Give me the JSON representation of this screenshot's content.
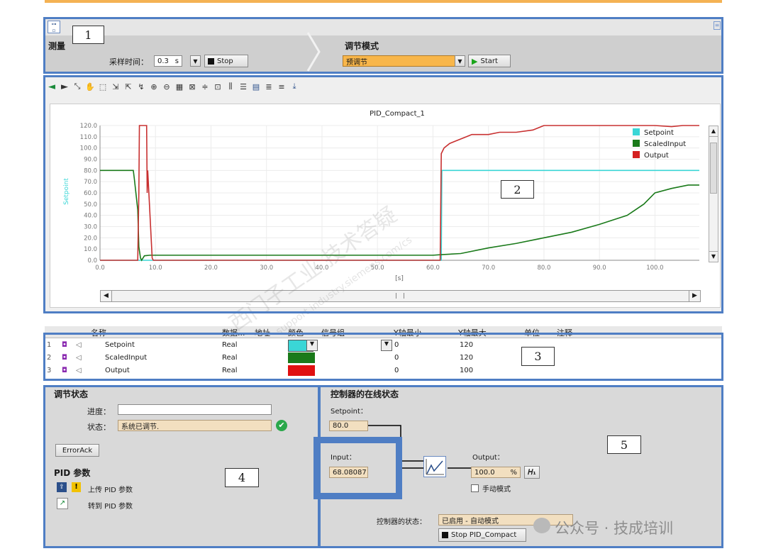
{
  "measure": {
    "title": "测量",
    "sample_time_label": "采样时间：",
    "sample_time_value": "0.3",
    "sample_time_unit": "s",
    "stop_label": "Stop"
  },
  "tuning_mode": {
    "title": "调节模式",
    "selected": "预调节",
    "start_label": "Start"
  },
  "annotations": [
    "1",
    "2",
    "3",
    "4",
    "5"
  ],
  "chart_data": {
    "type": "line",
    "title": "PID_Compact_1",
    "ylabel": "Setpoint",
    "xlabel": "[s]",
    "xlim": [
      0,
      108
    ],
    "ylim": [
      0,
      120
    ],
    "x_ticks": [
      "0.0",
      "10.0",
      "20.0",
      "30.0",
      "40.0",
      "50.0",
      "60.0",
      "70.0",
      "80.0",
      "90.0",
      "100.0"
    ],
    "y_ticks": [
      "120.0",
      "110.0",
      "100.0",
      "90.0",
      "80.0",
      "70.0",
      "60.0",
      "50.0",
      "40.0",
      "30.0",
      "20.0",
      "10.0",
      "0.0"
    ],
    "legend": "top-right",
    "series": [
      {
        "name": "Setpoint",
        "color": "#3ad6d6",
        "x": [
          0,
          61.5,
          61.6,
          108
        ],
        "y": [
          0,
          0,
          80,
          80
        ]
      },
      {
        "name": "ScaledInput",
        "color": "#1a7a1a",
        "x": [
          0,
          6,
          6.2,
          6.8,
          7,
          7.3,
          7.5,
          8,
          9,
          20,
          40,
          60,
          61.5,
          65,
          70,
          75,
          80,
          85,
          90,
          95,
          98,
          100,
          103,
          106,
          108
        ],
        "y": [
          80,
          80,
          72,
          45,
          12,
          2,
          0,
          4,
          4.5,
          4.5,
          4.5,
          4.5,
          5,
          6,
          11,
          15,
          20,
          25,
          32,
          40,
          50,
          60,
          64,
          67,
          67
        ]
      },
      {
        "name": "Output",
        "color": "#c83030",
        "x": [
          0,
          6.8,
          7,
          7.1,
          8.4,
          8.5,
          8.6,
          9.4,
          9.6,
          10,
          20,
          40,
          60,
          61.3,
          61.5,
          62,
          63,
          64,
          65,
          66,
          67,
          68,
          70,
          72,
          75,
          78,
          80,
          85,
          90,
          95,
          100,
          103,
          105,
          108
        ],
        "y": [
          0,
          0,
          60,
          120,
          120,
          60,
          80,
          2,
          0,
          0,
          0,
          0,
          0,
          0,
          95,
          100,
          104,
          106,
          108,
          110,
          112,
          112,
          112,
          114,
          114,
          116,
          120,
          120,
          120,
          120,
          120,
          119,
          120,
          120
        ]
      }
    ]
  },
  "signal_table": {
    "headers": [
      "名称",
      "数据...",
      "地址",
      "颜色",
      "信号组",
      "Y轴最小",
      "Y轴最大",
      "单位",
      "注释"
    ],
    "rows": [
      {
        "index": "1",
        "name": "Setpoint",
        "type": "Real",
        "color": "#3ad6d6",
        "ymin": "0",
        "ymax": "120"
      },
      {
        "index": "2",
        "name": "ScaledInput",
        "type": "Real",
        "color": "#1a7a1a",
        "ymin": "0",
        "ymax": "120"
      },
      {
        "index": "3",
        "name": "Output",
        "type": "Real",
        "color": "#e01010",
        "ymin": "0",
        "ymax": "100"
      }
    ]
  },
  "tuning_status": {
    "title": "调节状态",
    "progress_label": "进度：",
    "progress_value": "",
    "status_label": "状态：",
    "status_value": "系统已调节.",
    "errorack_label": "ErrorAck",
    "pid_params_title": "PID 参数",
    "upload_label": "上传 PID 参数",
    "goto_label": "转到 PID 参数"
  },
  "online_status": {
    "title": "控制器的在线状态",
    "setpoint_label": "Setpoint：",
    "setpoint_value": "80.0",
    "input_label": "Input：",
    "input_value": "68.08087",
    "output_label": "Output：",
    "output_value": "100.0",
    "output_unit": "%",
    "manual_label": "手动模式",
    "controller_state_label": "控制器的状态：",
    "controller_state_value": "已启用 - 自动模式",
    "stop_pid_label": "Stop PID_Compact"
  },
  "watermark": {
    "brand": "公众号 · 技成培训",
    "site": "support.industry.siemens.com/cs",
    "cn": "西门子工业 技术答疑"
  },
  "colors": {
    "frame": "#4f7ec4",
    "panel": "#d9d9d9",
    "orange_top": "#f4b253"
  }
}
